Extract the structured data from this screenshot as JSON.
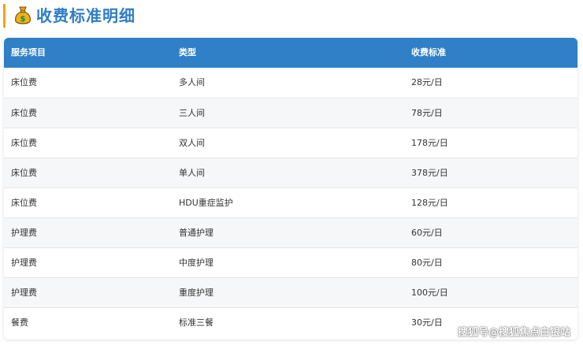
{
  "page": {
    "title": "收费标准明细",
    "title_icon": "money-bag-icon"
  },
  "colors": {
    "accent_bar": "#f2a31c",
    "title": "#2e7dc4",
    "header_bg": "#2f80c7",
    "stripe": "#f6f7f8"
  },
  "table": {
    "headers": [
      "服务项目",
      "类型",
      "收费标准"
    ],
    "rows": [
      [
        "床位费",
        "多人间",
        "28元/日"
      ],
      [
        "床位费",
        "三人间",
        "78元/日"
      ],
      [
        "床位费",
        "双人间",
        "178元/日"
      ],
      [
        "床位费",
        "单人间",
        "378元/日"
      ],
      [
        "床位费",
        "HDU重症监护",
        "128元/日"
      ],
      [
        "护理费",
        "普通护理",
        "60元/日"
      ],
      [
        "护理费",
        "中度护理",
        "80元/日"
      ],
      [
        "护理费",
        "重度护理",
        "100元/日"
      ],
      [
        "餐费",
        "标准三餐",
        "30元/日"
      ]
    ]
  },
  "watermark": "搜狐号@搜狐焦点白银站"
}
